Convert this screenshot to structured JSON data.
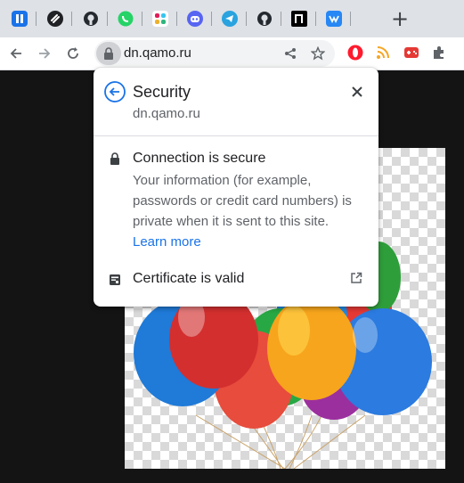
{
  "tabs": [
    {
      "icon": "pause-icon",
      "color": "#1a73e8"
    },
    {
      "icon": "link-icon",
      "color": "#202124"
    },
    {
      "icon": "github-icon",
      "color": "#24292f"
    },
    {
      "icon": "whatsapp-icon",
      "color": "#25d366"
    },
    {
      "icon": "slack-icon",
      "color": "#e01e5a"
    },
    {
      "icon": "discord-icon",
      "color": "#5865f2"
    },
    {
      "icon": "telegram-icon",
      "color": "#2aa3df"
    },
    {
      "icon": "github-icon",
      "color": "#24292f"
    },
    {
      "icon": "notion-icon",
      "color": "#000000"
    },
    {
      "icon": "vk-icon",
      "color": "#2787f5"
    }
  ],
  "new_tab_label": "+",
  "toolbar": {
    "back_icon": "back-arrow-icon",
    "forward_icon": "forward-arrow-icon",
    "reload_icon": "reload-icon",
    "url": "dn.qamo.ru",
    "share_icon": "share-icon",
    "bookmark_icon": "star-icon",
    "extensions": [
      "opera-icon",
      "rss-icon",
      "gamepad-icon",
      "puzzle-icon"
    ]
  },
  "popup": {
    "title": "Security",
    "domain": "dn.qamo.ru",
    "connection_title": "Connection is secure",
    "connection_desc": "Your information (for example, passwords or credit card numbers) is private when it is sent to this site.",
    "learn_more": "Learn more",
    "certificate_label": "Certificate is valid"
  },
  "colors": {
    "accent": "#1a73e8",
    "page_bg": "#141414",
    "popup_text": "#202124",
    "secondary_text": "#5f6368"
  }
}
